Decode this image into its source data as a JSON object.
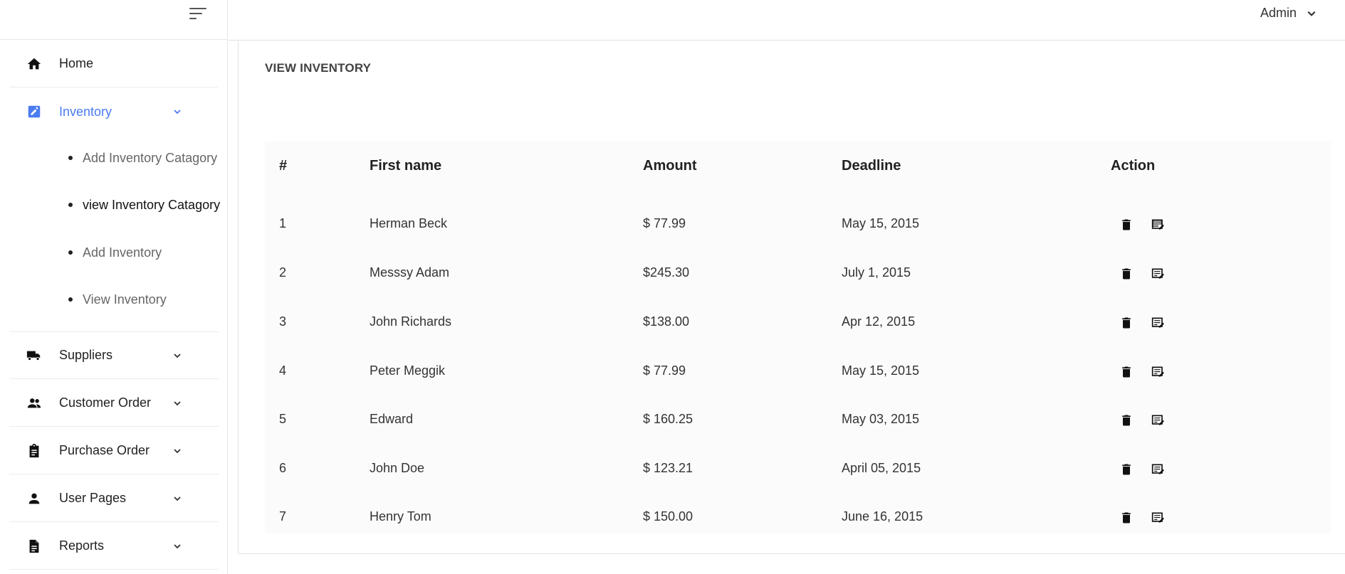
{
  "sidebar": {
    "items": [
      {
        "label": "Home",
        "icon": "home-icon"
      },
      {
        "label": "Inventory",
        "icon": "edit-square-icon"
      },
      {
        "label": "Suppliers",
        "icon": "truck-icon"
      },
      {
        "label": "Customer Order",
        "icon": "people-icon"
      },
      {
        "label": "Purchase Order",
        "icon": "clipboard-icon"
      },
      {
        "label": "User Pages",
        "icon": "person-icon"
      },
      {
        "label": "Reports",
        "icon": "document-icon"
      }
    ],
    "inventory_sub": [
      {
        "label": "Add Inventory Catagory"
      },
      {
        "label": "view Inventory Catagory"
      },
      {
        "label": "Add Inventory"
      },
      {
        "label": "View Inventory"
      }
    ]
  },
  "header": {
    "user_label": "Admin"
  },
  "main": {
    "title": "VIEW INVENTORY",
    "table": {
      "headers": [
        "#",
        "First name",
        "Amount",
        "Deadline",
        "Action"
      ],
      "rows": [
        {
          "num": "1",
          "name": "Herman Beck",
          "amount": "$ 77.99",
          "deadline": "May 15, 2015"
        },
        {
          "num": "2",
          "name": "Messsy Adam",
          "amount": "$245.30",
          "deadline": "July 1, 2015"
        },
        {
          "num": "3",
          "name": "John Richards",
          "amount": "$138.00",
          "deadline": "Apr 12, 2015"
        },
        {
          "num": "4",
          "name": "Peter Meggik",
          "amount": "$ 77.99",
          "deadline": "May 15, 2015"
        },
        {
          "num": "5",
          "name": "Edward",
          "amount": "$ 160.25",
          "deadline": "May 03, 2015"
        },
        {
          "num": "6",
          "name": "John Doe",
          "amount": "$ 123.21",
          "deadline": "April 05, 2015"
        },
        {
          "num": "7",
          "name": "Henry Tom",
          "amount": "$ 150.00",
          "deadline": "June 16, 2015"
        }
      ]
    }
  },
  "colors": {
    "accent": "#4a7bf0",
    "text": "#212121",
    "muted": "#666666"
  }
}
